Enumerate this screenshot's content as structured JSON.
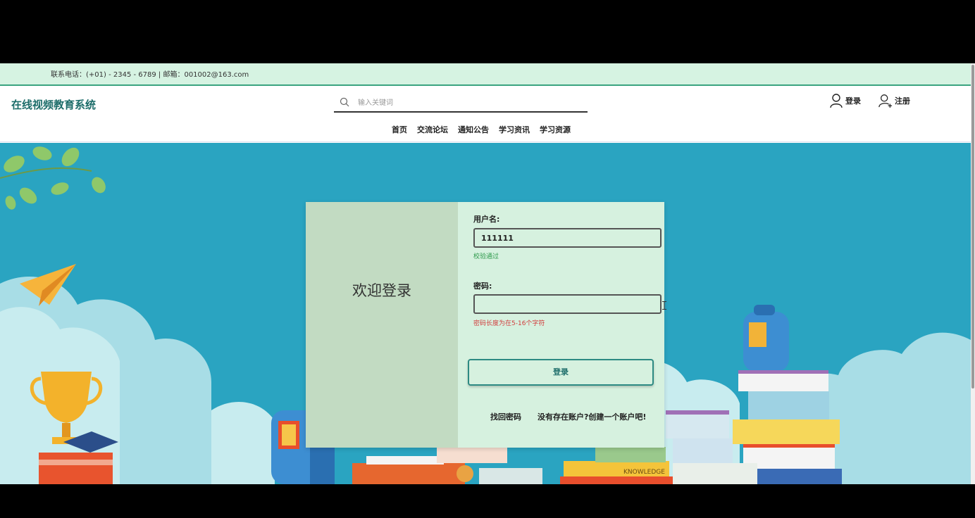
{
  "topbar": {
    "contact": "联系电话：(+01) - 2345 - 6789 | 邮箱：001002@163.com"
  },
  "header": {
    "brand": "在线视频教育系统",
    "search": {
      "placeholder": "输入关键词",
      "value": ""
    },
    "login_label": "登录",
    "register_label": "注册"
  },
  "nav": {
    "items": [
      {
        "label": "首页"
      },
      {
        "label": "交流论坛"
      },
      {
        "label": "通知公告"
      },
      {
        "label": "学习资讯"
      },
      {
        "label": "学习资源"
      }
    ]
  },
  "login_card": {
    "welcome": "欢迎登录",
    "username_label": "用户名:",
    "username_value": "111111",
    "username_hint": "校验通过",
    "password_label": "密码:",
    "password_value": "",
    "password_hint": "密码长度为在5-16个字符",
    "submit_label": "登录",
    "forgot_link": "找回密码",
    "register_link": "没有存在账户?创建一个账户吧!"
  },
  "colors": {
    "topbar_bg": "#d6f3e2",
    "accent": "#1d6d6a",
    "scene_bg": "#2aa4c1",
    "card_left_bg": "#c2dbc2",
    "card_right_bg": "#d6f1df",
    "success": "#2e9a4c",
    "error": "#d23c3c"
  },
  "scene_text": {
    "knowledge_label": "KNOWLEDGE"
  }
}
